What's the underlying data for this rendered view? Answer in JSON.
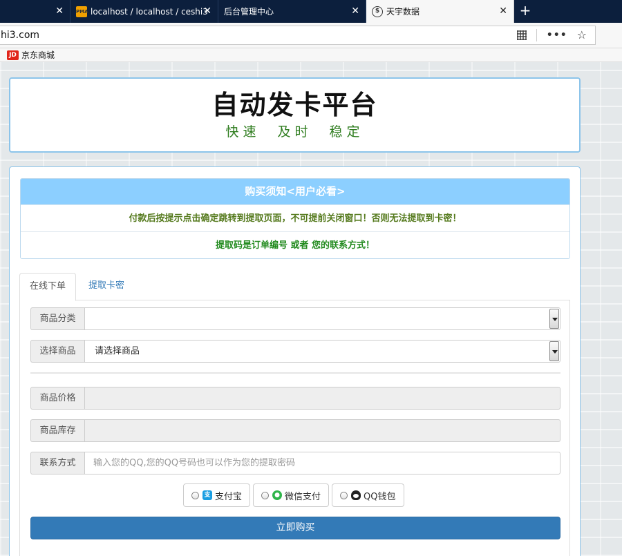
{
  "browser": {
    "tabs": [
      {
        "label": "",
        "favicon": ""
      },
      {
        "label": "localhost / localhost / ceshi3",
        "favicon": "phpmyadmin-icon"
      },
      {
        "label": "后台管理中心",
        "favicon": ""
      },
      {
        "label": "天宇数据",
        "favicon": "globe-data-icon"
      }
    ],
    "url": "hi3.com",
    "bookmark": {
      "icon_text": "JD",
      "label": "京东商城"
    }
  },
  "header": {
    "title": "自动发卡平台",
    "subtitle": "快速　及时　稳定"
  },
  "notice": {
    "heading": "购买须知<用户必看>",
    "line1": "付款后按提示点击确定跳转到提取页面，不可提前关闭窗口！否则无法提取到卡密！",
    "line2": "提取码是订单编号 或者 您的联系方式！"
  },
  "tabs": {
    "order": "在线下单",
    "extract": "提取卡密"
  },
  "form": {
    "category_label": "商品分类",
    "category_value": "",
    "product_label": "选择商品",
    "product_value": "请选择商品",
    "price_label": "商品价格",
    "price_value": "",
    "stock_label": "商品库存",
    "stock_value": "",
    "contact_label": "联系方式",
    "contact_placeholder": "输入您的QQ,您的QQ号码也可以作为您的提取密码"
  },
  "payment": {
    "alipay": "支付宝",
    "wechat": "微信支付",
    "qq": "QQ钱包"
  },
  "submit_label": "立即购买",
  "colors": {
    "notice_header": "#8ccfff",
    "primary_button": "#337ab7",
    "subtitle": "#2f7d1f"
  }
}
